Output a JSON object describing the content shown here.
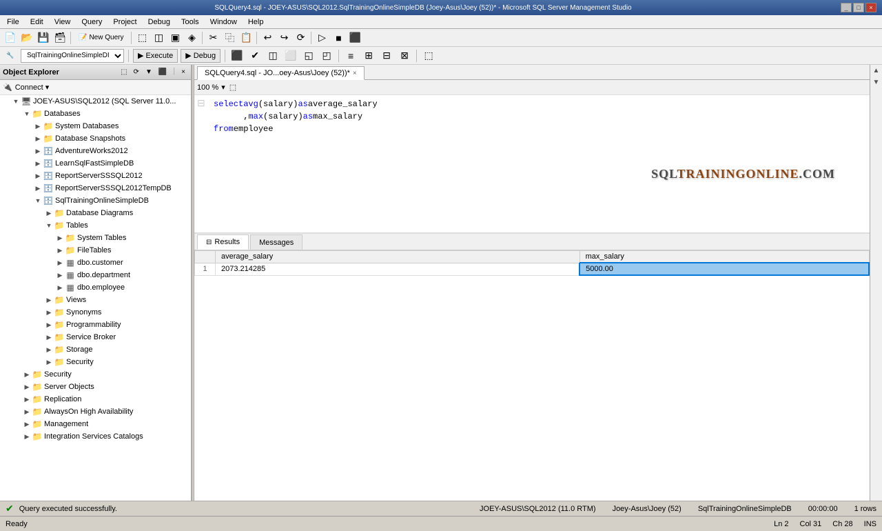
{
  "titlebar": {
    "text": "SQLQuery4.sql - JOEY-ASUS\\SQL2012.SqlTrainingOnlineSimpleDB (Joey-Asus\\Joey (52))* - Microsoft SQL Server Management Studio",
    "controls": [
      "_",
      "□",
      "×"
    ]
  },
  "menu": {
    "items": [
      "File",
      "Edit",
      "View",
      "Query",
      "Project",
      "Debug",
      "Tools",
      "Window",
      "Help"
    ]
  },
  "toolbar1": {
    "dropdown_value": "SqlTrainingOnlineSimpleDI",
    "execute_label": "Execute",
    "debug_label": "Debug"
  },
  "tabs": [
    {
      "label": "SQLQuery4.sql - JO...oey-Asus\\Joey (52))*",
      "active": true,
      "closable": true
    }
  ],
  "object_explorer": {
    "title": "Object Explorer",
    "connect_label": "Connect",
    "server": "JOEY-ASUS\\SQL2012 (SQL Server 11.0...",
    "tree": [
      {
        "level": 0,
        "expanded": true,
        "label": "JOEY-ASUS\\SQL2012 (SQL Server 11.0...",
        "type": "server"
      },
      {
        "level": 1,
        "expanded": true,
        "label": "Databases",
        "type": "folder"
      },
      {
        "level": 2,
        "expanded": false,
        "label": "System Databases",
        "type": "folder"
      },
      {
        "level": 2,
        "expanded": false,
        "label": "Database Snapshots",
        "type": "folder"
      },
      {
        "level": 2,
        "expanded": false,
        "label": "AdventureWorks2012",
        "type": "db"
      },
      {
        "level": 2,
        "expanded": false,
        "label": "LearnSqlFastSimpleDB",
        "type": "db"
      },
      {
        "level": 2,
        "expanded": false,
        "label": "ReportServerSSQL2012",
        "type": "db"
      },
      {
        "level": 2,
        "expanded": false,
        "label": "ReportServerSSQL2012TempDB",
        "type": "db"
      },
      {
        "level": 2,
        "expanded": true,
        "label": "SqlTrainingOnlineSimpleDB",
        "type": "db"
      },
      {
        "level": 3,
        "expanded": false,
        "label": "Database Diagrams",
        "type": "folder"
      },
      {
        "level": 3,
        "expanded": true,
        "label": "Tables",
        "type": "folder"
      },
      {
        "level": 4,
        "expanded": false,
        "label": "System Tables",
        "type": "folder"
      },
      {
        "level": 4,
        "expanded": false,
        "label": "FileTables",
        "type": "folder"
      },
      {
        "level": 4,
        "expanded": false,
        "label": "dbo.customer",
        "type": "table"
      },
      {
        "level": 4,
        "expanded": false,
        "label": "dbo.department",
        "type": "table"
      },
      {
        "level": 4,
        "expanded": false,
        "label": "dbo.employee",
        "type": "table"
      },
      {
        "level": 3,
        "expanded": false,
        "label": "Views",
        "type": "folder"
      },
      {
        "level": 3,
        "expanded": false,
        "label": "Synonyms",
        "type": "folder"
      },
      {
        "level": 3,
        "expanded": false,
        "label": "Programmability",
        "type": "folder"
      },
      {
        "level": 3,
        "expanded": false,
        "label": "Service Broker",
        "type": "folder"
      },
      {
        "level": 3,
        "expanded": false,
        "label": "Storage",
        "type": "folder"
      },
      {
        "level": 3,
        "expanded": false,
        "label": "Security",
        "type": "folder"
      },
      {
        "level": 1,
        "expanded": false,
        "label": "Security",
        "type": "folder"
      },
      {
        "level": 1,
        "expanded": false,
        "label": "Server Objects",
        "type": "folder"
      },
      {
        "level": 1,
        "expanded": false,
        "label": "Replication",
        "type": "folder"
      },
      {
        "level": 1,
        "expanded": false,
        "label": "AlwaysOn High Availability",
        "type": "folder"
      },
      {
        "level": 1,
        "expanded": false,
        "label": "Management",
        "type": "folder"
      },
      {
        "level": 1,
        "expanded": false,
        "label": "Integration Services Catalogs",
        "type": "folder"
      }
    ]
  },
  "editor": {
    "zoom": "100 %",
    "sql_lines": [
      {
        "num": "",
        "content_type": "bracket",
        "text": "⊟"
      },
      {
        "num": "",
        "parts": [
          {
            "type": "kw",
            "text": "select"
          },
          {
            "type": "fn",
            "text": " avg"
          },
          {
            "type": "id",
            "text": "(salary)"
          },
          {
            "type": "kw",
            "text": " as"
          },
          {
            "type": "id",
            "text": " average_salary"
          }
        ]
      },
      {
        "num": "",
        "parts": [
          {
            "type": "id",
            "text": "      ,"
          },
          {
            "type": "fn",
            "text": "max"
          },
          {
            "type": "id",
            "text": "(salary)"
          },
          {
            "type": "kw",
            "text": " as"
          },
          {
            "type": "id",
            "text": " max_salary"
          }
        ]
      },
      {
        "num": "",
        "parts": [
          {
            "type": "kw",
            "text": "from"
          },
          {
            "type": "id",
            "text": " employee"
          }
        ]
      }
    ]
  },
  "results": {
    "tabs": [
      {
        "label": "Results",
        "active": true
      },
      {
        "label": "Messages",
        "active": false
      }
    ],
    "columns": [
      "",
      "average_salary",
      "max_salary"
    ],
    "rows": [
      {
        "num": "1",
        "values": [
          "2073.214285",
          "5000.00"
        ]
      }
    ],
    "selected_cell": "5000.00"
  },
  "status_bar": {
    "query_status": "Query executed successfully.",
    "server": "JOEY-ASUS\\SQL2012 (11.0 RTM)",
    "user": "Joey-Asus\\Joey (52)",
    "db": "SqlTrainingOnlineSimpleDB",
    "time": "00:00:00",
    "rows": "1 rows",
    "ready": "Ready",
    "ln": "Ln 2",
    "col": "Col 31",
    "ch": "Ch 28",
    "ins": "INS"
  },
  "logo": {
    "text": "SqlTrainingOnline.com"
  }
}
